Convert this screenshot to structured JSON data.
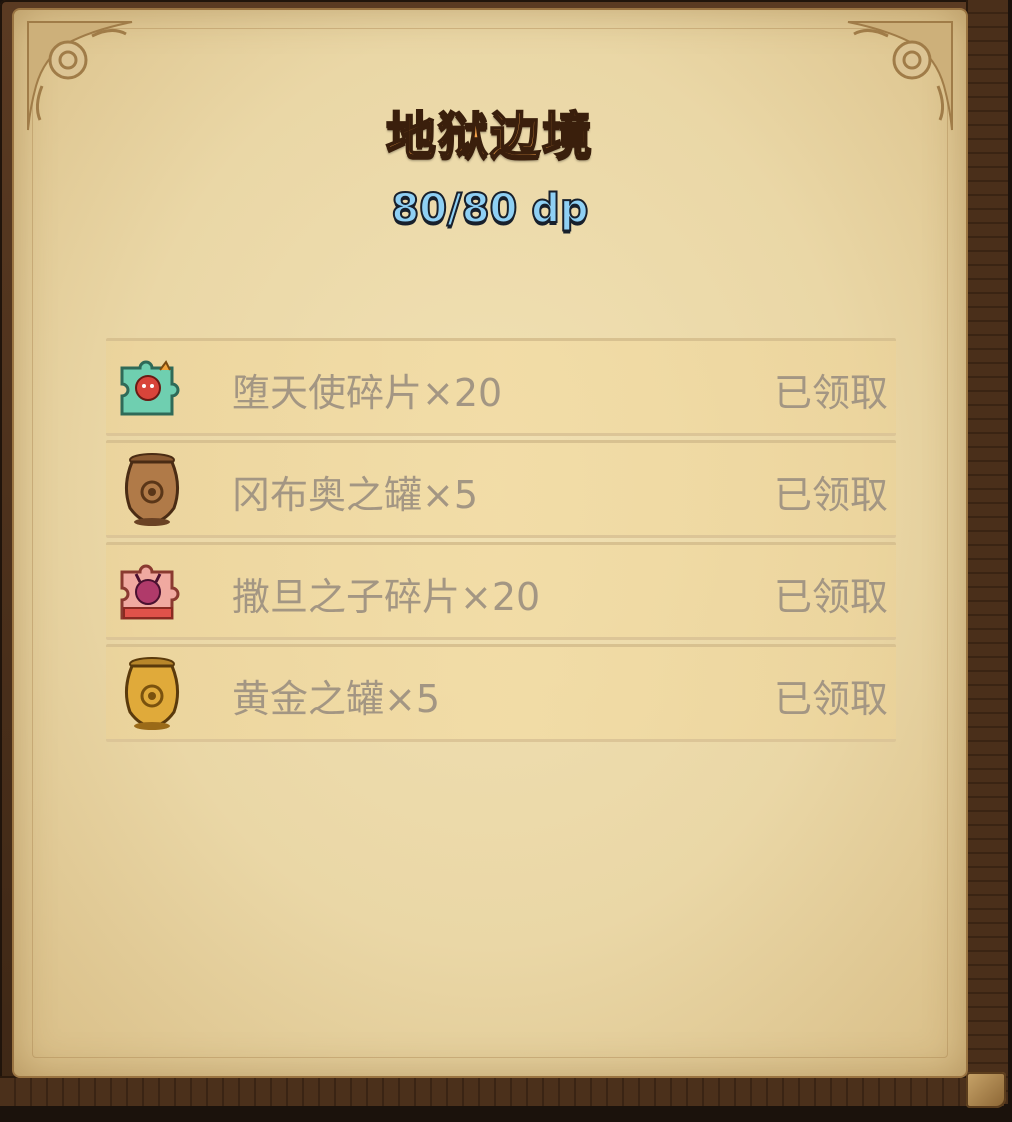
{
  "panel": {
    "title": "地狱边境",
    "points": "80/80 dp"
  },
  "rewards": [
    {
      "icon": "fallen-angel-fragment-icon",
      "name": "堕天使碎片×20",
      "status": "已领取"
    },
    {
      "icon": "bronze-jar-icon",
      "name": "冈布奥之罐×5",
      "status": "已领取"
    },
    {
      "icon": "satan-son-fragment-icon",
      "name": "撒旦之子碎片×20",
      "status": "已领取"
    },
    {
      "icon": "golden-jar-icon",
      "name": "黄金之罐×5",
      "status": "已领取"
    }
  ],
  "colors": {
    "title": "#f4a24a",
    "points": "#8fd0f4",
    "claimed_text": "#a39683",
    "parchment": "#ead7a6"
  }
}
